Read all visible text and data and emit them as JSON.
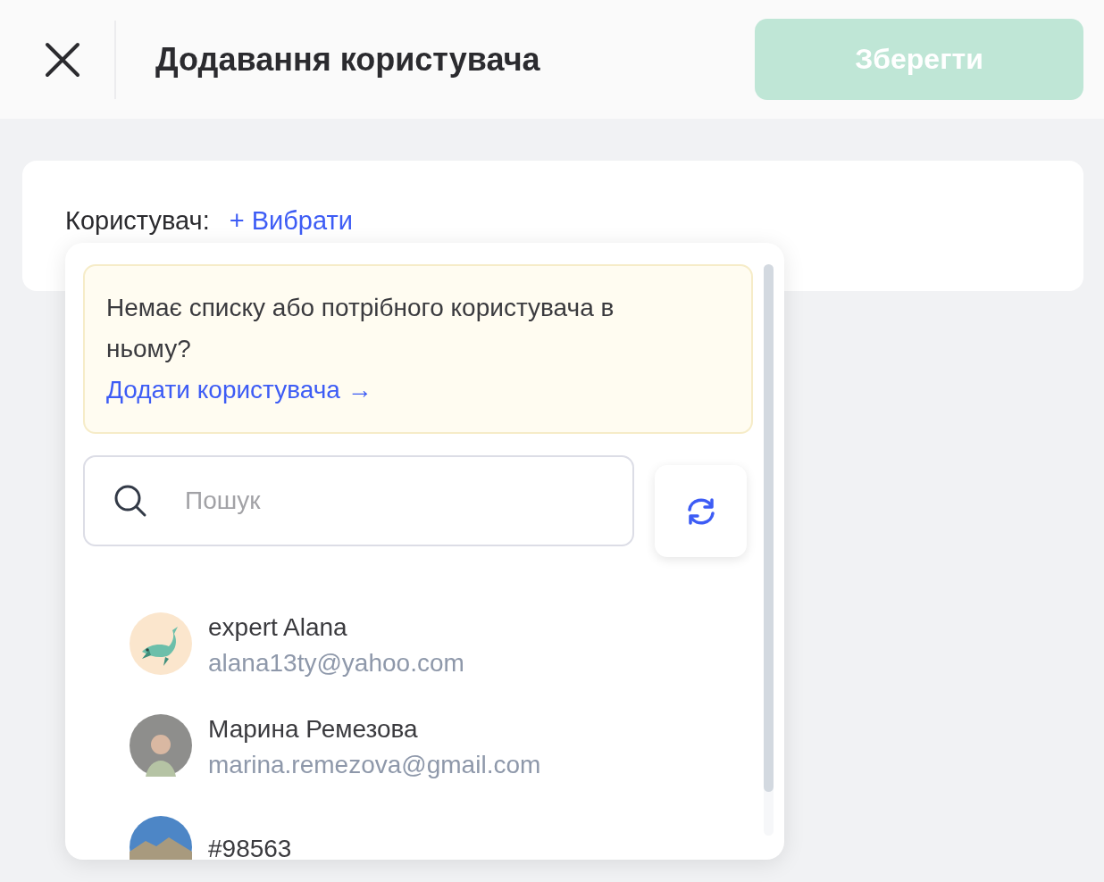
{
  "header": {
    "title": "Додавання користувача",
    "save_button": {
      "label": "Зберегти",
      "disabled": true
    }
  },
  "field": {
    "label": "Користувач:",
    "action": "+ Вибрати"
  },
  "dropdown": {
    "notice": {
      "text": "Немає списку або потрібного користувача в ньому?",
      "link": "Додати користувача →"
    },
    "search": {
      "placeholder": "Пошук"
    },
    "users": [
      {
        "kind": "illustration",
        "name": "expert Alana",
        "email": "alana13ty@yahoo.com"
      },
      {
        "kind": "portrait",
        "name": "Марина Ремезова",
        "email": "marina.remezova@gmail.com"
      },
      {
        "kind": "landscape",
        "name": "#98563"
      }
    ]
  }
}
